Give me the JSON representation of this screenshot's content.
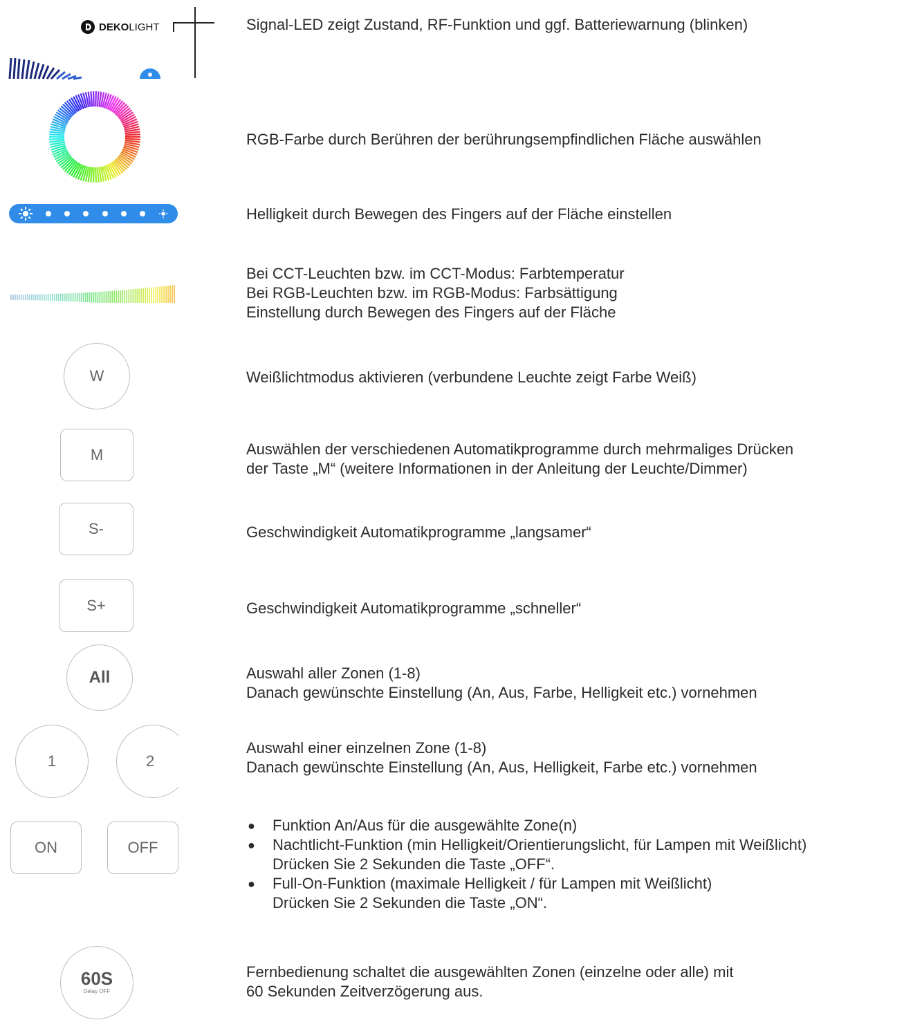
{
  "brand": {
    "logo_text_bold": "DEKO",
    "logo_text_light": "LIGHT",
    "logo_icon": "dekolight-logo-icon"
  },
  "colors": {
    "accent_blue": "#2f8ce8",
    "dark_navy": "#1b2a7a",
    "button_border": "#bdbdbd",
    "button_text": "#666666",
    "text": "#2b2b2b"
  },
  "rows": {
    "signal_led": {
      "text": "Signal-LED zeigt Zustand, RF-Funktion und ggf. Batteriewarnung (blinken)"
    },
    "rgb_wheel": {
      "text": "RGB-Farbe durch Berühren der berührungsempfindlichen Fläche auswählen"
    },
    "brightness_slider": {
      "text": "Helligkeit durch Bewegen des Fingers auf der Fläche einstellen",
      "icon": "sun-icon"
    },
    "cct_slider": {
      "lines": [
        "Bei CCT-Leuchten bzw. im CCT-Modus: Farbtemperatur",
        "Bei RGB-Leuchten bzw. im RGB-Modus: Farbsättigung",
        "Einstellung durch Bewegen des Fingers auf der Fläche"
      ]
    },
    "w_button": {
      "label": "W",
      "text": "Weißlichtmodus aktivieren (verbundene Leuchte zeigt Farbe Weiß)"
    },
    "m_button": {
      "label": "M",
      "lines": [
        "Auswählen der verschiedenen Automatikprogramme durch mehrmaliges Drücken",
        "der Taste „M“ (weitere Informationen in der Anleitung der Leuchte/Dimmer)"
      ]
    },
    "s_minus_button": {
      "label": "S-",
      "text": "Geschwindigkeit Automatikprogramme „langsamer“"
    },
    "s_plus_button": {
      "label": "S+",
      "text": "Geschwindigkeit Automatikprogramme „schneller“"
    },
    "all_button": {
      "label": "All",
      "lines": [
        "Auswahl aller Zonen (1-8)",
        "Danach gewünschte Einstellung (An, Aus, Farbe, Helligkeit etc.) vornehmen"
      ]
    },
    "zone_buttons": {
      "label_1": "1",
      "label_2": "2",
      "lines": [
        "Auswahl einer einzelnen Zone (1-8)",
        "Danach gewünschte Einstellung (An, Aus, Helligkeit, Farbe etc.) vornehmen"
      ]
    },
    "on_off_buttons": {
      "label_on": "ON",
      "label_off": "OFF",
      "bullets": [
        {
          "lines": [
            "Funktion An/Aus für die ausgewählte Zone(n)"
          ]
        },
        {
          "lines": [
            "Nachtlicht-Funktion (min Helligkeit/Orientierungslicht, für Lampen mit Weißlicht)",
            "Drücken Sie 2 Sekunden die Taste „OFF“."
          ]
        },
        {
          "lines": [
            "Full-On-Funktion (maximale Helligkeit / für Lampen mit Weißlicht)",
            "Drücken Sie 2 Sekunden die Taste „ON“."
          ]
        }
      ]
    },
    "delay_button": {
      "label_main": "60S",
      "label_sub": "Delay OFF",
      "lines": [
        "Fernbedienung schaltet die ausgewählten Zonen (einzelne oder alle) mit",
        "60 Sekunden Zeitverzögerung aus."
      ]
    }
  }
}
